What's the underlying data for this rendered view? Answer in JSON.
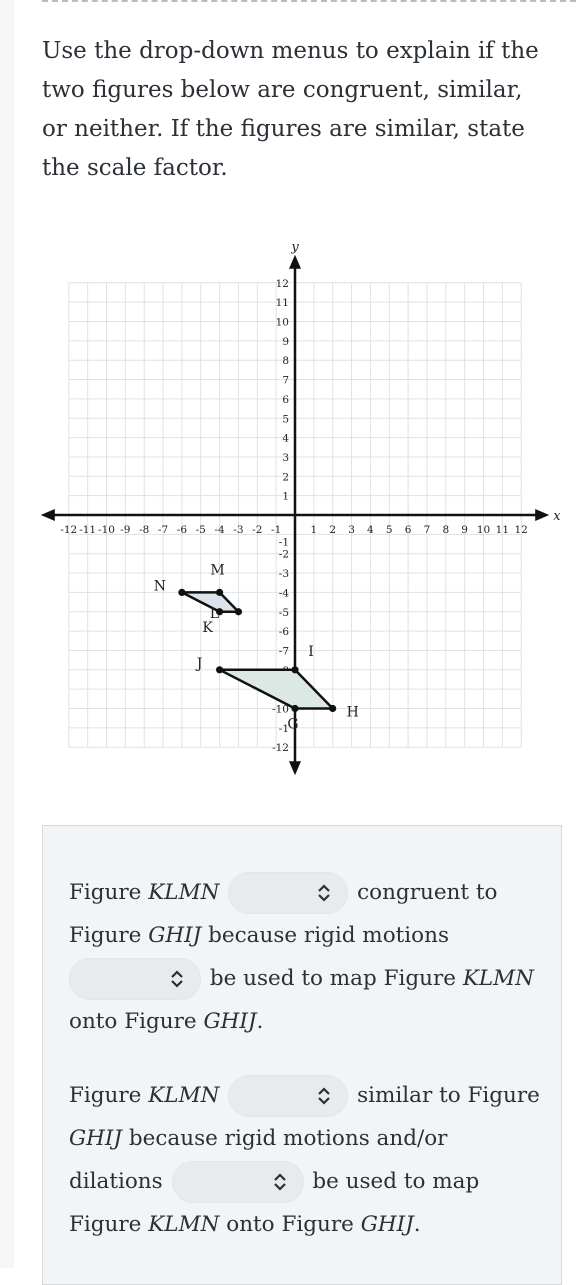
{
  "prompt": {
    "text": "Use the drop-down menus to explain if the two figures below are congruent, similar, or neither. If the figures are similar, state the scale factor."
  },
  "chart_data": {
    "type": "scatter",
    "title": "",
    "xlabel": "x",
    "ylabel": "y",
    "xlim": [
      -12,
      12
    ],
    "ylim": [
      -12,
      12
    ],
    "grid": true,
    "x_ticks": [
      -12,
      -11,
      -10,
      -9,
      -8,
      -7,
      -6,
      -5,
      -4,
      -3,
      -2,
      -1,
      1,
      2,
      3,
      4,
      5,
      6,
      7,
      8,
      9,
      10,
      11,
      12
    ],
    "y_ticks": [
      12,
      11,
      10,
      9,
      8,
      7,
      6,
      5,
      4,
      3,
      2,
      1,
      -1,
      -2,
      -3,
      -4,
      -5,
      -6,
      -7,
      -8,
      -9,
      -10,
      -11,
      -12
    ],
    "y_tick_labels": {
      "-11": "-1"
    },
    "figures": [
      {
        "name": "KLMN",
        "vertices": [
          {
            "label": "K",
            "x": -4,
            "y": -5
          },
          {
            "label": "L",
            "x": -3,
            "y": -5
          },
          {
            "label": "M",
            "x": -4,
            "y": -4
          },
          {
            "label": "N",
            "x": -6,
            "y": -4
          }
        ],
        "fill": "#dbe4ec"
      },
      {
        "name": "GHIJ",
        "vertices": [
          {
            "label": "G",
            "x": 0,
            "y": -10
          },
          {
            "label": "H",
            "x": 2,
            "y": -10
          },
          {
            "label": "I",
            "x": 0,
            "y": -8
          },
          {
            "label": "J",
            "x": -4,
            "y": -8
          }
        ],
        "fill": "#dce8e4"
      }
    ]
  },
  "answer": {
    "para1": {
      "t1": "Figure ",
      "fig1": "KLMN",
      "t2": " congruent to",
      "t3": "Figure ",
      "fig2": "GHIJ",
      "t4": " because rigid motions",
      "t5": " be used to map Figure ",
      "fig3": "KLMN",
      "t6": "onto Figure ",
      "fig4": "GHIJ",
      "t7": ".",
      "dropdown1_value": "",
      "dropdown2_value": ""
    },
    "para2": {
      "t1": "Figure ",
      "fig1": "KLMN",
      "t2": " similar to Figure",
      "fig2": "GHIJ",
      "t3": " because rigid motions and/or",
      "t4": "dilations ",
      "t5": " be used to map",
      "t6": "Figure ",
      "fig3": "KLMN",
      "t7": " onto Figure ",
      "fig4": "GHIJ",
      "t8": ".",
      "dropdown3_value": "",
      "dropdown4_value": ""
    }
  }
}
